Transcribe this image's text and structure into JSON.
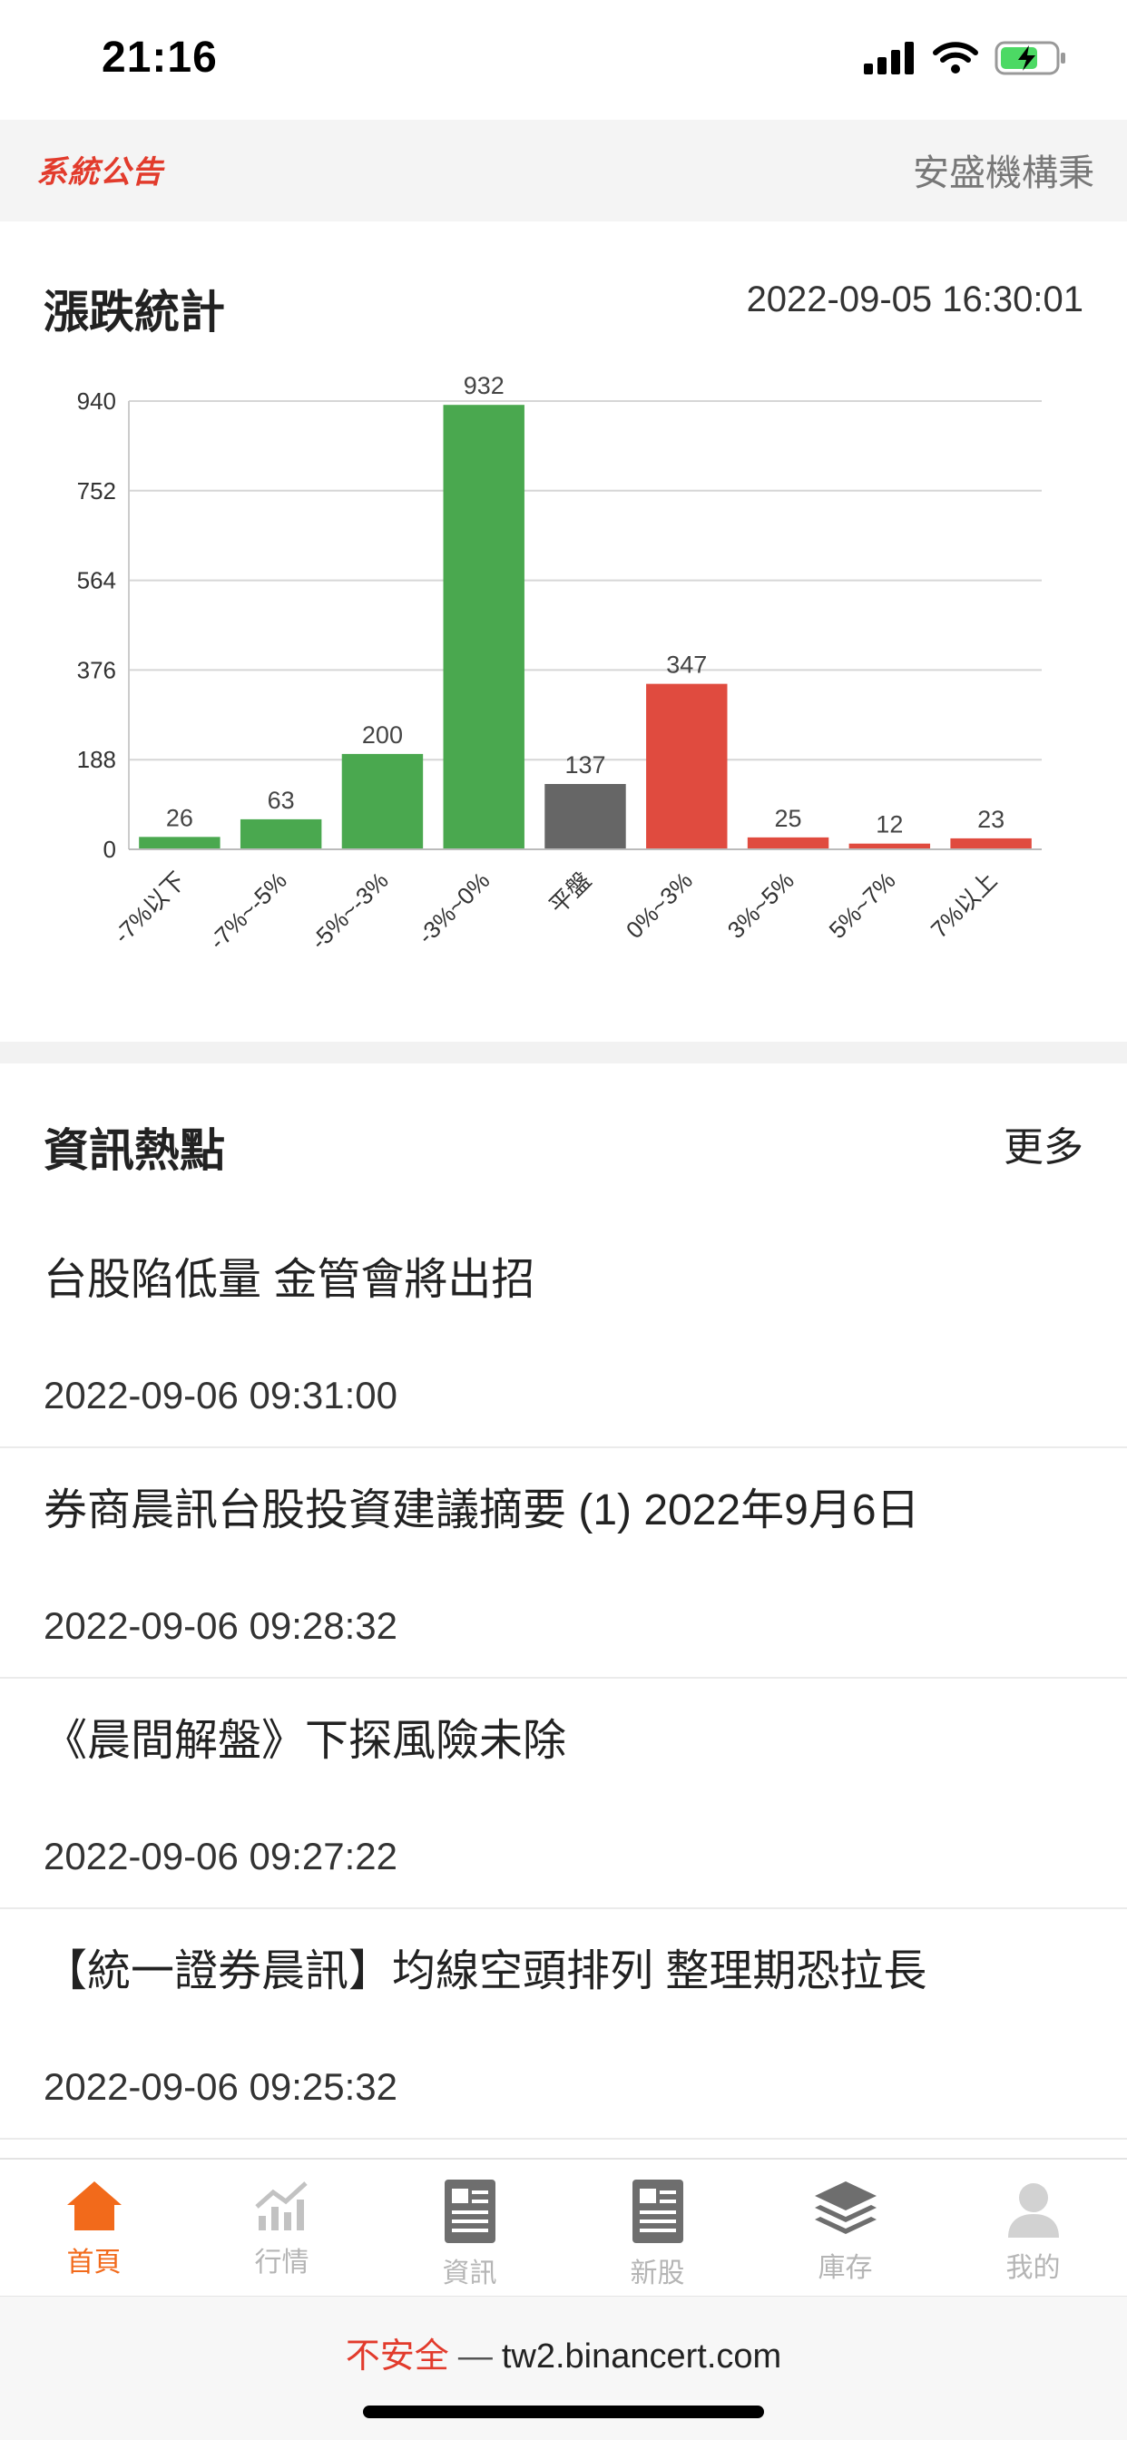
{
  "status_bar": {
    "time": "21:16"
  },
  "announcement": {
    "label": "系統公告",
    "text": "安盛機構秉"
  },
  "stats": {
    "title": "漲跌統計",
    "datetime": "2022-09-05 16:30:01"
  },
  "chart_data": {
    "type": "bar",
    "categories": [
      "-7%以下",
      "-7%~-5%",
      "-5%~-3%",
      "-3%~0%",
      "平盤",
      "0%~3%",
      "3%~5%",
      "5%~7%",
      "7%以上"
    ],
    "values": [
      26,
      63,
      200,
      932,
      137,
      347,
      25,
      12,
      23
    ],
    "colors": [
      "#4aa84f",
      "#4aa84f",
      "#4aa84f",
      "#4aa84f",
      "#666666",
      "#e04b3f",
      "#e04b3f",
      "#e04b3f",
      "#e04b3f"
    ],
    "yticks": [
      0,
      188,
      376,
      564,
      752,
      940
    ],
    "ylim": [
      0,
      940
    ],
    "grid": true
  },
  "news": {
    "title": "資訊熱點",
    "more_label": "更多",
    "items": [
      {
        "title": "台股陷低量 金管會將出招",
        "time": "2022-09-06 09:31:00"
      },
      {
        "title": "券商晨訊台股投資建議摘要 (1) 2022年9月6日",
        "time": "2022-09-06 09:28:32"
      },
      {
        "title": "《晨間解盤》下探風險未除",
        "time": "2022-09-06 09:27:22"
      },
      {
        "title": "【統一證券晨訊】均線空頭排列 整理期恐拉長",
        "time": "2022-09-06 09:25:32"
      }
    ]
  },
  "tabbar": {
    "active_color": "#f26a1b",
    "tabs": [
      {
        "label": "首頁",
        "icon": "home-icon"
      },
      {
        "label": "行情",
        "icon": "chart-icon"
      },
      {
        "label": "資訊",
        "icon": "news-icon"
      },
      {
        "label": "新股",
        "icon": "new-stock-icon"
      },
      {
        "label": "庫存",
        "icon": "layers-icon"
      },
      {
        "label": "我的",
        "icon": "user-icon"
      }
    ]
  },
  "url_bar": {
    "insecure_label": "不安全",
    "domain": "tw2.binancert.com"
  }
}
